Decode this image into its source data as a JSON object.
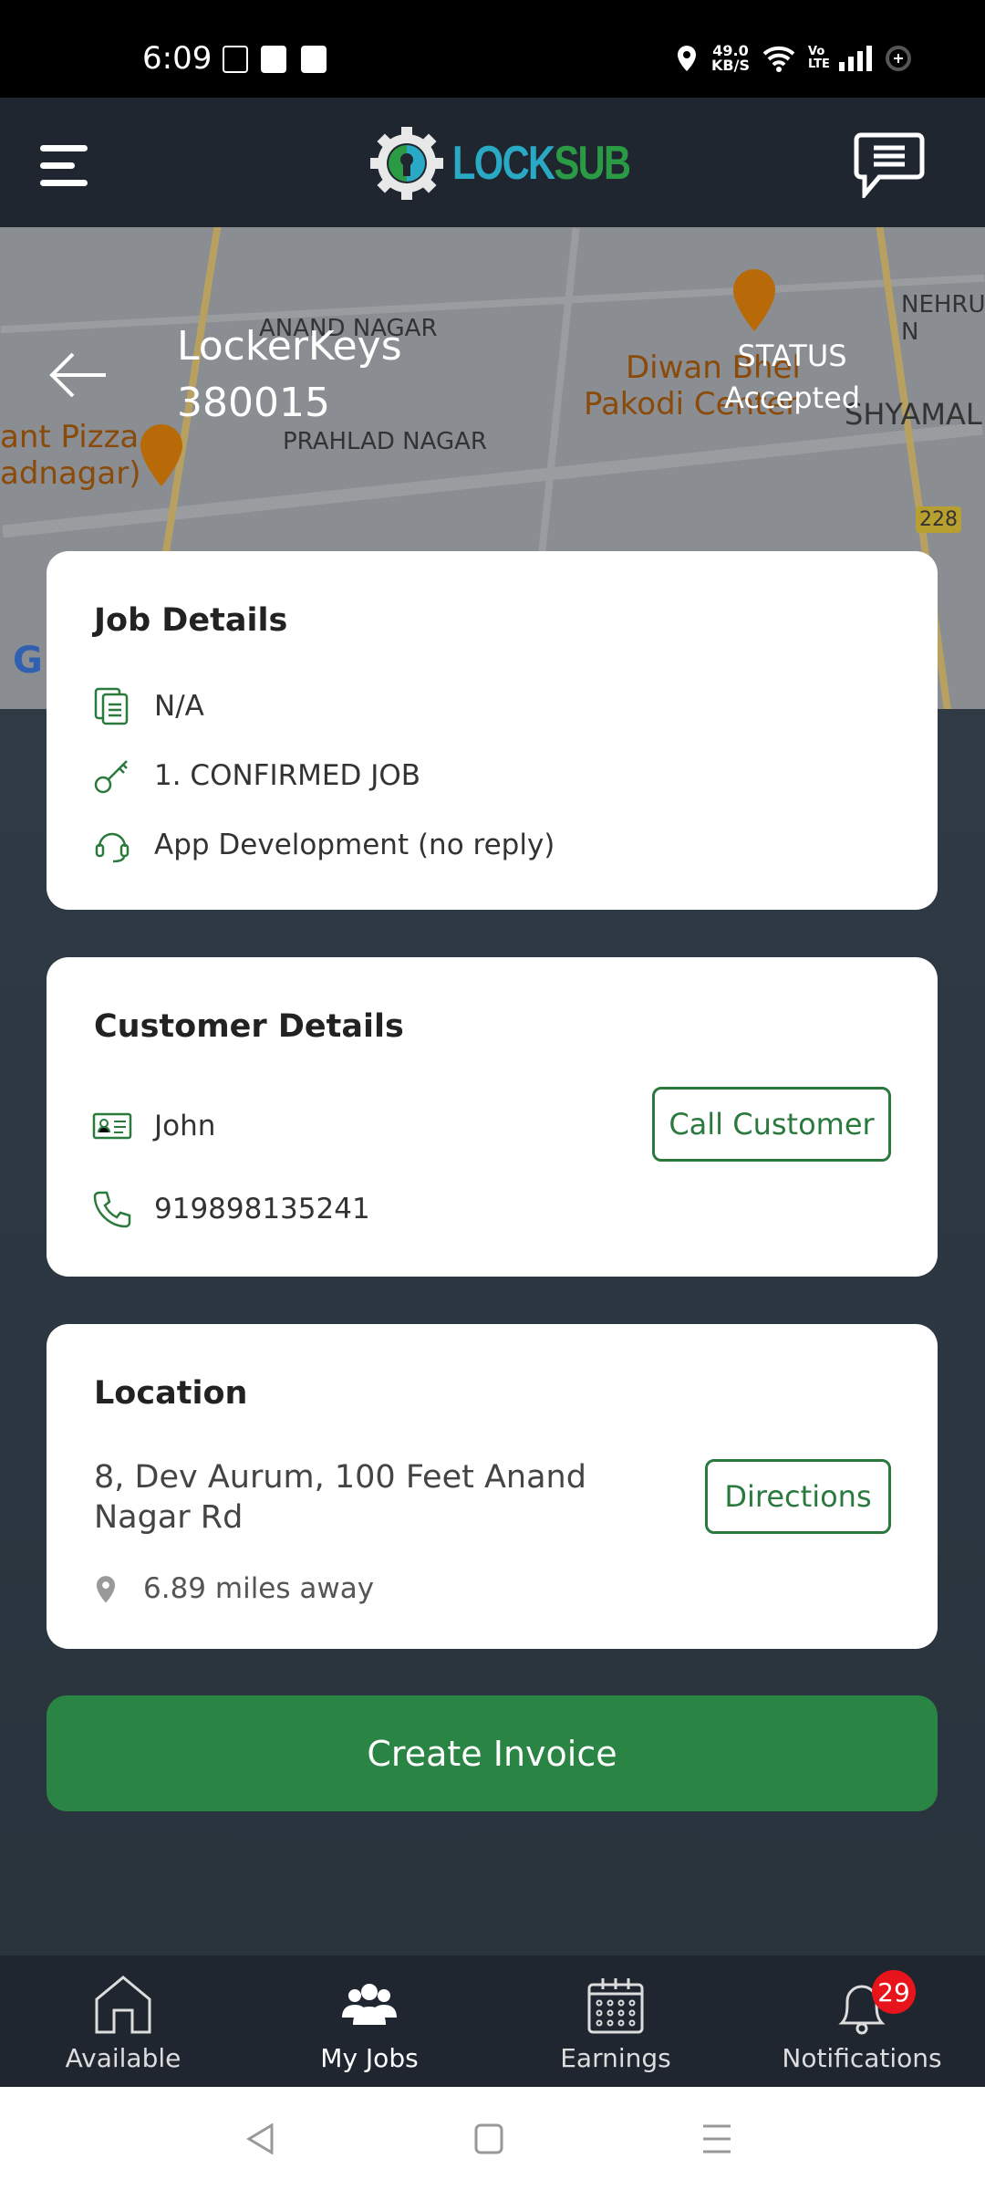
{
  "status_bar": {
    "time": "6:09",
    "net_speed": "49.0",
    "net_unit": "KB/S",
    "volte": "Vo LTE"
  },
  "header": {
    "logo_lock": "LOCK",
    "logo_sub": "SUB"
  },
  "map": {
    "labels": [
      "ANAND NAGAR",
      "PRAHLAD NAGAR",
      "NEHRU N",
      "SHYAMAL",
      "Diwan Bhel",
      "Pakodi Center",
      "ant Pizza",
      "adnagar)",
      "228",
      "G"
    ]
  },
  "job": {
    "title_line1": "LockerKeys",
    "title_line2": "380015",
    "status_label": "STATUS",
    "status_value": "Accepted"
  },
  "job_details": {
    "heading": "Job Details",
    "items": [
      {
        "icon": "document-icon",
        "text": "N/A"
      },
      {
        "icon": "key-icon",
        "text": "1. CONFIRMED JOB"
      },
      {
        "icon": "headset-icon",
        "text": "App Development (no reply)"
      }
    ]
  },
  "customer": {
    "heading": "Customer Details",
    "name": "John",
    "phone": "919898135241",
    "call_label": "Call Customer"
  },
  "location": {
    "heading": "Location",
    "address": "8, Dev Aurum,  100 Feet Anand Nagar Rd",
    "distance": "6.89 miles away",
    "directions_label": "Directions"
  },
  "actions": {
    "create_invoice": "Create Invoice"
  },
  "bottom_nav": {
    "items": [
      {
        "label": "Available",
        "icon": "home-icon"
      },
      {
        "label": "My Jobs",
        "icon": "group-icon",
        "active": true
      },
      {
        "label": "Earnings",
        "icon": "calendar-icon"
      },
      {
        "label": "Notifications",
        "icon": "bell-icon",
        "badge": "29"
      }
    ]
  },
  "colors": {
    "accent": "#2a8443",
    "header": "#1f2630",
    "badge": "#e8141b",
    "logo_lock": "#2aa9c4",
    "logo_sub": "#2a9a45"
  }
}
